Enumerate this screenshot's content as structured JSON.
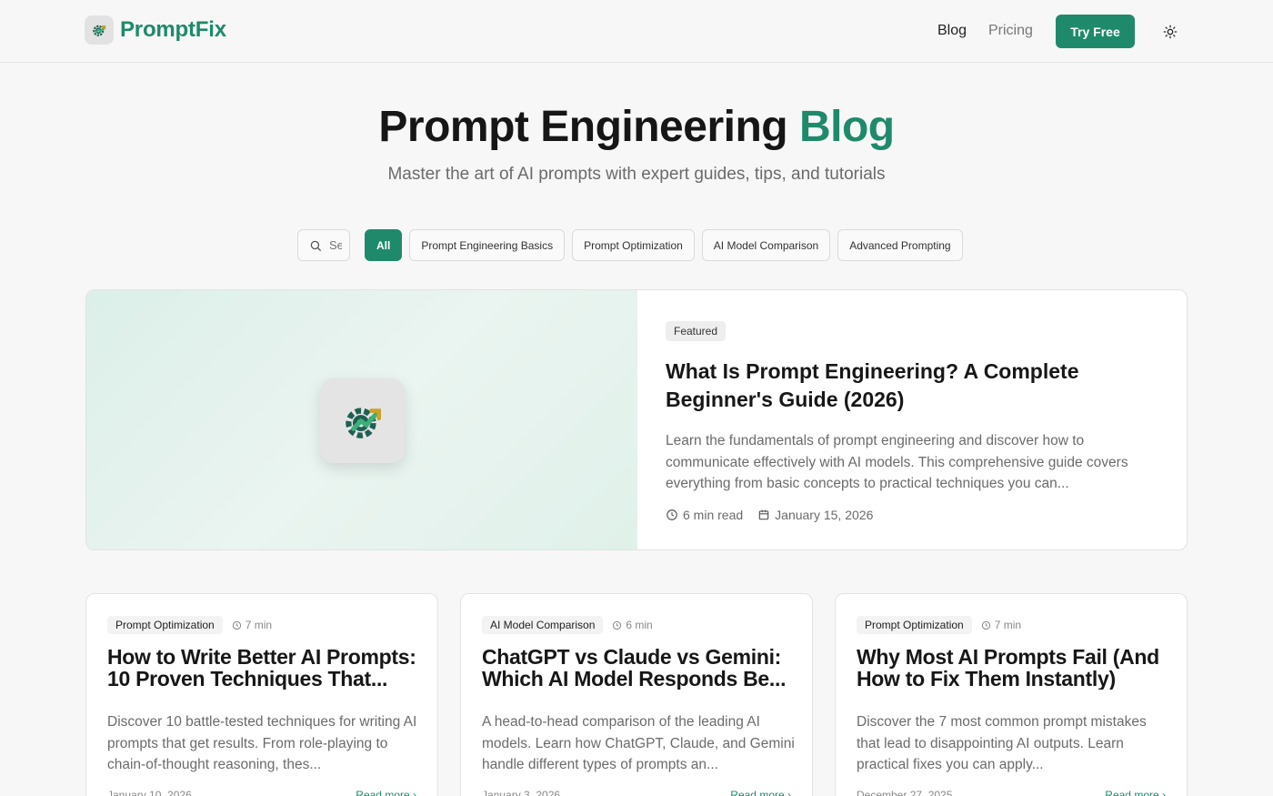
{
  "header": {
    "logo_text": "PromptFix",
    "nav": {
      "blog": "Blog",
      "pricing": "Pricing",
      "try_free": "Try Free"
    }
  },
  "hero": {
    "title_main": "Prompt Engineering",
    "title_accent": "Blog",
    "subtitle": "Master the art of AI prompts with expert guides, tips, and tutorials"
  },
  "search": {
    "placeholder": "Search articles..."
  },
  "filters": {
    "all": "All",
    "basics": "Prompt Engineering Basics",
    "optimization": "Prompt Optimization",
    "comparison": "AI Model Comparison",
    "advanced": "Advanced Prompting"
  },
  "featured": {
    "badge": "Featured",
    "title": "What Is Prompt Engineering? A Complete Beginner's Guide (2026)",
    "excerpt": "Learn the fundamentals of prompt engineering and discover how to communicate effectively with AI models. This comprehensive guide covers everything from basic concepts to practical techniques you can...",
    "read_time": "6 min read",
    "date": "January 15, 2026"
  },
  "posts": [
    {
      "category": "Prompt Optimization",
      "read_time": "7 min",
      "title": "How to Write Better AI Prompts: 10 Proven Techniques That...",
      "excerpt": "Discover 10 battle-tested techniques for writing AI prompts that get results. From role-playing to chain-of-thought reasoning, thes...",
      "date": "January 10, 2026",
      "read_more": "Read more ›"
    },
    {
      "category": "AI Model Comparison",
      "read_time": "6 min",
      "title": "ChatGPT vs Claude vs Gemini: Which AI Model Responds Be...",
      "excerpt": "A head-to-head comparison of the leading AI models. Learn how ChatGPT, Claude, and Gemini handle different types of prompts an...",
      "date": "January 3, 2026",
      "read_more": "Read more ›"
    },
    {
      "category": "Prompt Optimization",
      "read_time": "7 min",
      "title": "Why Most AI Prompts Fail (And How to Fix Them Instantly)",
      "excerpt": "Discover the 7 most common prompt mistakes that lead to disappointing AI outputs. Learn practical fixes you can apply...",
      "date": "December 27, 2025",
      "read_more": "Read more ›"
    }
  ],
  "colors": {
    "brand": "#1f8a6b",
    "background": "#f7f7f7",
    "muted_text": "#6b6b6b"
  },
  "icons": [
    "gear-chart-logo-icon",
    "sun-icon",
    "search-icon",
    "clock-icon",
    "calendar-icon"
  ]
}
